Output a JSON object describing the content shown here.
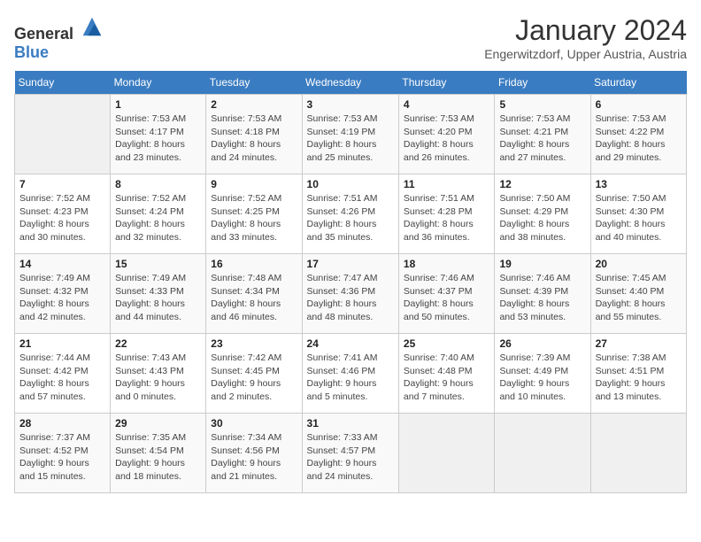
{
  "header": {
    "logo_general": "General",
    "logo_blue": "Blue",
    "month_title": "January 2024",
    "location": "Engerwitzdorf, Upper Austria, Austria"
  },
  "days_of_week": [
    "Sunday",
    "Monday",
    "Tuesday",
    "Wednesday",
    "Thursday",
    "Friday",
    "Saturday"
  ],
  "weeks": [
    [
      {
        "day": "",
        "info": ""
      },
      {
        "day": "1",
        "info": "Sunrise: 7:53 AM\nSunset: 4:17 PM\nDaylight: 8 hours\nand 23 minutes."
      },
      {
        "day": "2",
        "info": "Sunrise: 7:53 AM\nSunset: 4:18 PM\nDaylight: 8 hours\nand 24 minutes."
      },
      {
        "day": "3",
        "info": "Sunrise: 7:53 AM\nSunset: 4:19 PM\nDaylight: 8 hours\nand 25 minutes."
      },
      {
        "day": "4",
        "info": "Sunrise: 7:53 AM\nSunset: 4:20 PM\nDaylight: 8 hours\nand 26 minutes."
      },
      {
        "day": "5",
        "info": "Sunrise: 7:53 AM\nSunset: 4:21 PM\nDaylight: 8 hours\nand 27 minutes."
      },
      {
        "day": "6",
        "info": "Sunrise: 7:53 AM\nSunset: 4:22 PM\nDaylight: 8 hours\nand 29 minutes."
      }
    ],
    [
      {
        "day": "7",
        "info": "Sunrise: 7:52 AM\nSunset: 4:23 PM\nDaylight: 8 hours\nand 30 minutes."
      },
      {
        "day": "8",
        "info": "Sunrise: 7:52 AM\nSunset: 4:24 PM\nDaylight: 8 hours\nand 32 minutes."
      },
      {
        "day": "9",
        "info": "Sunrise: 7:52 AM\nSunset: 4:25 PM\nDaylight: 8 hours\nand 33 minutes."
      },
      {
        "day": "10",
        "info": "Sunrise: 7:51 AM\nSunset: 4:26 PM\nDaylight: 8 hours\nand 35 minutes."
      },
      {
        "day": "11",
        "info": "Sunrise: 7:51 AM\nSunset: 4:28 PM\nDaylight: 8 hours\nand 36 minutes."
      },
      {
        "day": "12",
        "info": "Sunrise: 7:50 AM\nSunset: 4:29 PM\nDaylight: 8 hours\nand 38 minutes."
      },
      {
        "day": "13",
        "info": "Sunrise: 7:50 AM\nSunset: 4:30 PM\nDaylight: 8 hours\nand 40 minutes."
      }
    ],
    [
      {
        "day": "14",
        "info": "Sunrise: 7:49 AM\nSunset: 4:32 PM\nDaylight: 8 hours\nand 42 minutes."
      },
      {
        "day": "15",
        "info": "Sunrise: 7:49 AM\nSunset: 4:33 PM\nDaylight: 8 hours\nand 44 minutes."
      },
      {
        "day": "16",
        "info": "Sunrise: 7:48 AM\nSunset: 4:34 PM\nDaylight: 8 hours\nand 46 minutes."
      },
      {
        "day": "17",
        "info": "Sunrise: 7:47 AM\nSunset: 4:36 PM\nDaylight: 8 hours\nand 48 minutes."
      },
      {
        "day": "18",
        "info": "Sunrise: 7:46 AM\nSunset: 4:37 PM\nDaylight: 8 hours\nand 50 minutes."
      },
      {
        "day": "19",
        "info": "Sunrise: 7:46 AM\nSunset: 4:39 PM\nDaylight: 8 hours\nand 53 minutes."
      },
      {
        "day": "20",
        "info": "Sunrise: 7:45 AM\nSunset: 4:40 PM\nDaylight: 8 hours\nand 55 minutes."
      }
    ],
    [
      {
        "day": "21",
        "info": "Sunrise: 7:44 AM\nSunset: 4:42 PM\nDaylight: 8 hours\nand 57 minutes."
      },
      {
        "day": "22",
        "info": "Sunrise: 7:43 AM\nSunset: 4:43 PM\nDaylight: 9 hours\nand 0 minutes."
      },
      {
        "day": "23",
        "info": "Sunrise: 7:42 AM\nSunset: 4:45 PM\nDaylight: 9 hours\nand 2 minutes."
      },
      {
        "day": "24",
        "info": "Sunrise: 7:41 AM\nSunset: 4:46 PM\nDaylight: 9 hours\nand 5 minutes."
      },
      {
        "day": "25",
        "info": "Sunrise: 7:40 AM\nSunset: 4:48 PM\nDaylight: 9 hours\nand 7 minutes."
      },
      {
        "day": "26",
        "info": "Sunrise: 7:39 AM\nSunset: 4:49 PM\nDaylight: 9 hours\nand 10 minutes."
      },
      {
        "day": "27",
        "info": "Sunrise: 7:38 AM\nSunset: 4:51 PM\nDaylight: 9 hours\nand 13 minutes."
      }
    ],
    [
      {
        "day": "28",
        "info": "Sunrise: 7:37 AM\nSunset: 4:52 PM\nDaylight: 9 hours\nand 15 minutes."
      },
      {
        "day": "29",
        "info": "Sunrise: 7:35 AM\nSunset: 4:54 PM\nDaylight: 9 hours\nand 18 minutes."
      },
      {
        "day": "30",
        "info": "Sunrise: 7:34 AM\nSunset: 4:56 PM\nDaylight: 9 hours\nand 21 minutes."
      },
      {
        "day": "31",
        "info": "Sunrise: 7:33 AM\nSunset: 4:57 PM\nDaylight: 9 hours\nand 24 minutes."
      },
      {
        "day": "",
        "info": ""
      },
      {
        "day": "",
        "info": ""
      },
      {
        "day": "",
        "info": ""
      }
    ]
  ]
}
